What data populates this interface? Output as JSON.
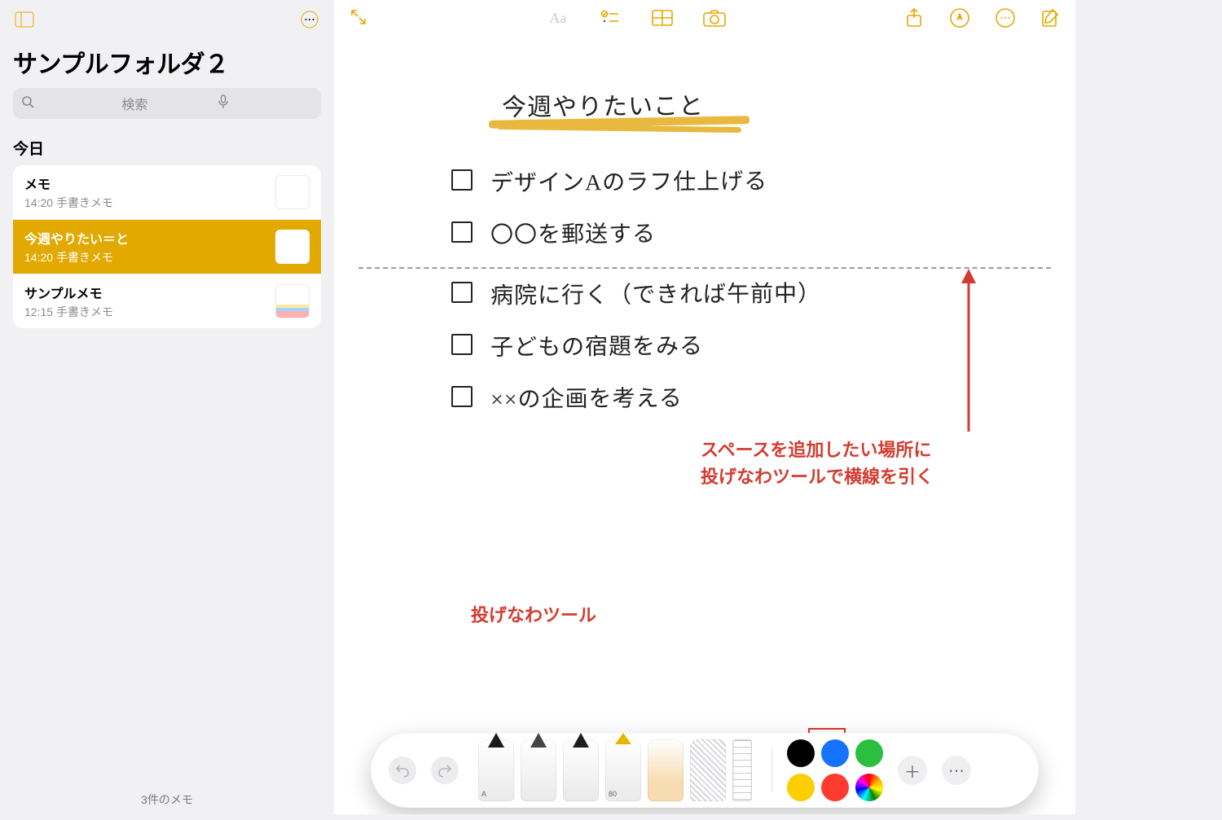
{
  "colors": {
    "accent": "#e6a800",
    "annotation": "#d43b30"
  },
  "sidebar": {
    "folder_title": "サンプルフォルダ２",
    "search_placeholder": "検索",
    "section_label": "今日",
    "notes": [
      {
        "title": "メモ",
        "time": "14:20",
        "subtitle": "手書きメモ",
        "selected": false
      },
      {
        "title": "今週やりたい＝と",
        "time": "14:20",
        "subtitle": "手書きメモ",
        "selected": true
      },
      {
        "title": "サンプルメモ",
        "time": "12:15",
        "subtitle": "手書きメモ",
        "selected": false
      }
    ],
    "footer": "3件のメモ"
  },
  "toolbar": {
    "icons": {
      "sidebar_toggle": "sidebar-layout-icon",
      "view_options": "ellipsis-circle-icon",
      "expand": "expand-arrows-icon",
      "text_format": "Aa",
      "checklist": "checklist-icon",
      "table": "table-grid-icon",
      "camera": "camera-icon",
      "share": "share-icon",
      "markup": "pen-circle-icon",
      "more": "ellipsis-circle-icon",
      "compose": "compose-icon"
    }
  },
  "canvas": {
    "title": "今週やりたいこと",
    "items": [
      "デザインAのラフ仕上げる",
      "〇〇を郵送する",
      "病院に行く（できれば午前中）",
      "子どもの宿題をみる",
      "××の企画を考える"
    ]
  },
  "annotation": {
    "lasso_label": "投げなわツール",
    "instruction_line1": "スペースを追加したい場所に",
    "instruction_line2": "投げなわツールで横線を引く"
  },
  "pencilkit": {
    "tools": [
      "pen",
      "pencil",
      "highlighter",
      "marker",
      "eraser",
      "lasso",
      "ruler"
    ],
    "marker_opacity_label": "80",
    "pencil_label": "A",
    "swatches": [
      "#000000",
      "#1573ff",
      "#2bbf3f",
      "#ffce00",
      "#ff3b30",
      "rainbow"
    ]
  }
}
